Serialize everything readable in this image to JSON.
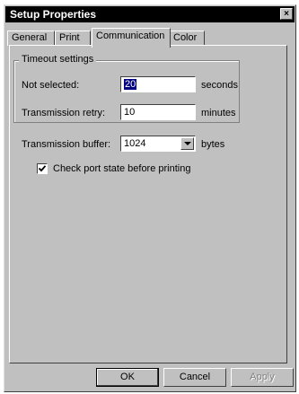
{
  "window": {
    "title": "Setup Properties",
    "close_glyph": "×"
  },
  "tabs": [
    {
      "label": "General",
      "active": false
    },
    {
      "label": "Print",
      "active": false
    },
    {
      "label": "Communication",
      "active": true
    },
    {
      "label": "Color",
      "active": false
    }
  ],
  "timeout_group": {
    "title": "Timeout settings",
    "not_selected": {
      "label": "Not selected:",
      "value": "20",
      "unit": "seconds"
    },
    "transmission_retry": {
      "label": "Transmission retry:",
      "value": "10",
      "unit": "minutes"
    }
  },
  "buffer": {
    "label": "Transmission buffer:",
    "value": "1024",
    "unit": "bytes"
  },
  "check_port": {
    "label": "Check port state before printing",
    "checked": true
  },
  "buttons": {
    "ok": "OK",
    "cancel": "Cancel",
    "apply": "Apply"
  }
}
